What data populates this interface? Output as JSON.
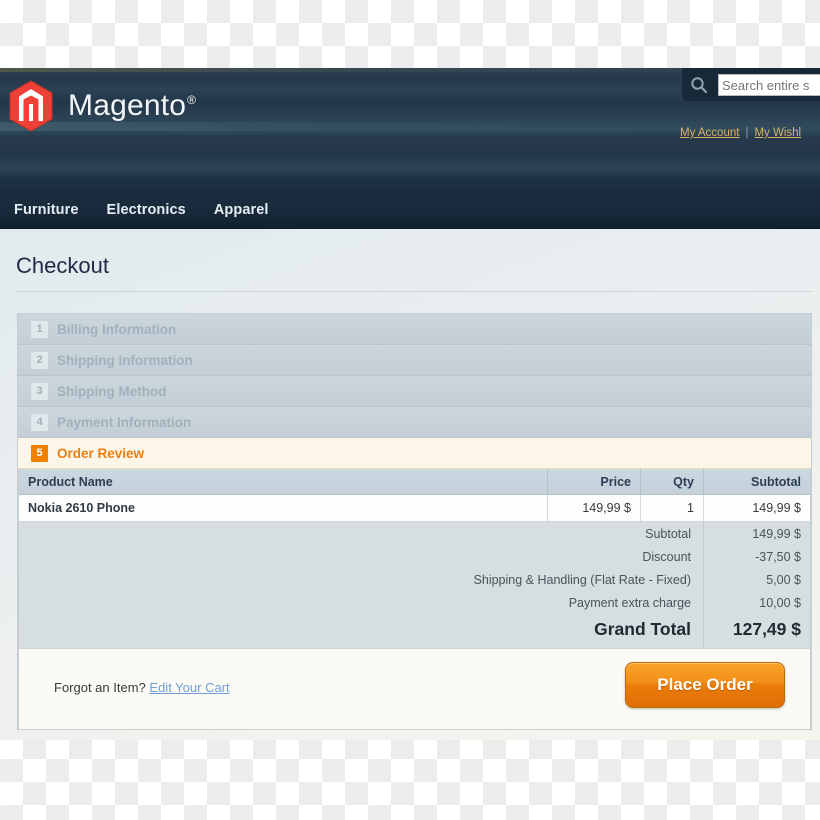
{
  "header": {
    "brand_name": "Magento",
    "brand_reg": "®",
    "search": {
      "icon": "search-icon",
      "placeholder": "Search entire s",
      "value": ""
    },
    "account_links": [
      {
        "label": "My Account"
      },
      {
        "label": "My Wishl"
      }
    ],
    "separator": "|"
  },
  "nav": {
    "items": [
      {
        "label": "Furniture"
      },
      {
        "label": "Electronics"
      },
      {
        "label": "Apparel"
      }
    ]
  },
  "page": {
    "title": "Checkout"
  },
  "checkout": {
    "steps": [
      {
        "num": "1",
        "label": "Billing Information",
        "active": false
      },
      {
        "num": "2",
        "label": "Shipping Information",
        "active": false
      },
      {
        "num": "3",
        "label": "Shipping Method",
        "active": false
      },
      {
        "num": "4",
        "label": "Payment Information",
        "active": false
      },
      {
        "num": "5",
        "label": "Order Review",
        "active": true
      }
    ]
  },
  "review": {
    "columns": {
      "name": "Product Name",
      "price": "Price",
      "qty": "Qty",
      "subtotal": "Subtotal"
    },
    "rows": [
      {
        "name": "Nokia 2610 Phone",
        "price": "149,99 $",
        "qty": "1",
        "subtotal": "149,99 $"
      }
    ],
    "totals": [
      {
        "label": "Subtotal",
        "value": "149,99 $"
      },
      {
        "label": "Discount",
        "value": "-37,50 $"
      },
      {
        "label": "Shipping & Handling (Flat Rate - Fixed)",
        "value": "5,00 $"
      },
      {
        "label": "Payment extra charge",
        "value": "10,00 $"
      }
    ],
    "grand_total": {
      "label": "Grand Total",
      "value": "127,49 $"
    }
  },
  "actions": {
    "forgot_text": "Forgot an Item?",
    "edit_cart_link": "Edit Your Cart",
    "place_order_label": "Place Order"
  },
  "colors": {
    "accent_orange": "#f08000",
    "header_dark": "#24374a",
    "nav_dark": "#17293a",
    "link_gold": "#d9b264",
    "link_blue": "#6f9fd8",
    "active_step_bg": "#fcf6e8",
    "logo_red": "#ee4036"
  }
}
